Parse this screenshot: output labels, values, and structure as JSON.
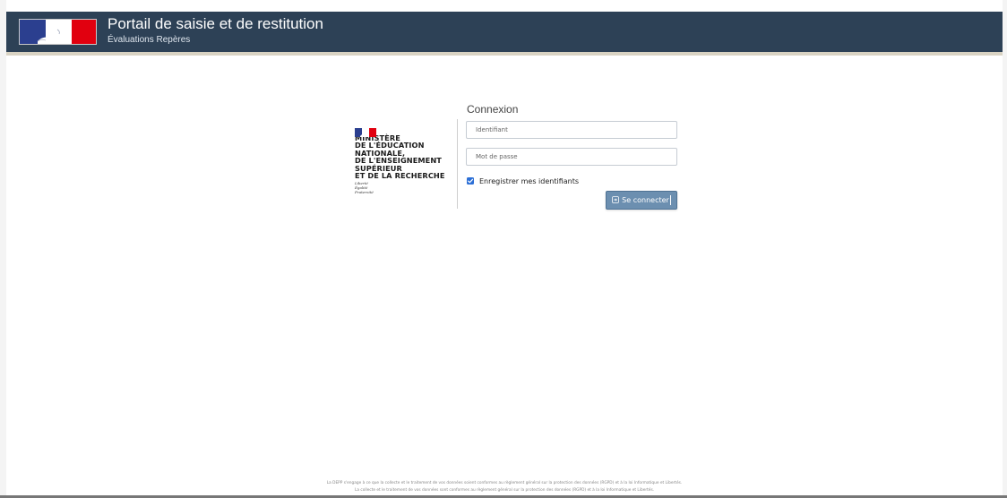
{
  "header": {
    "title": "Portail de saisie et de restitution",
    "subtitle": "Évaluations Repères"
  },
  "ministry": {
    "name": "MINISTÈRE\nDE L'ÉDUCATION\nNATIONALE,\nDE L'ENSEIGNEMENT\nSUPÉRIEUR\nET DE LA RECHERCHE",
    "motto": "Liberté\nÉgalité\nFraternité"
  },
  "login": {
    "heading": "Connexion",
    "identifier_placeholder": "Identifiant",
    "password_placeholder": "Mot de passe",
    "remember_label": "Enregistrer mes identifiants",
    "remember_checked": true,
    "submit_label": "Se connecter"
  },
  "footer": {
    "line1": "La DEPP s'engage à ce que la collecte et le traitement de vos données soient conformes au règlement général sur la protection des données (RGPD) et à la loi Informatique et Libertés.",
    "line2": "La collecte et le traitement de vos données sont conformes au règlement général sur la protection des données (RGPD) et à la loi Informatique et Libertés."
  },
  "colors": {
    "header_bg": "#2d4156",
    "button_bg": "#6c8fb0",
    "checkbox": "#2c6fd6",
    "flag_blue": "#2b3f8f",
    "flag_red": "#e1000f"
  },
  "icons": {
    "logo": "marianne-flag-icon",
    "checkbox": "check-icon",
    "submit": "login-icon"
  }
}
